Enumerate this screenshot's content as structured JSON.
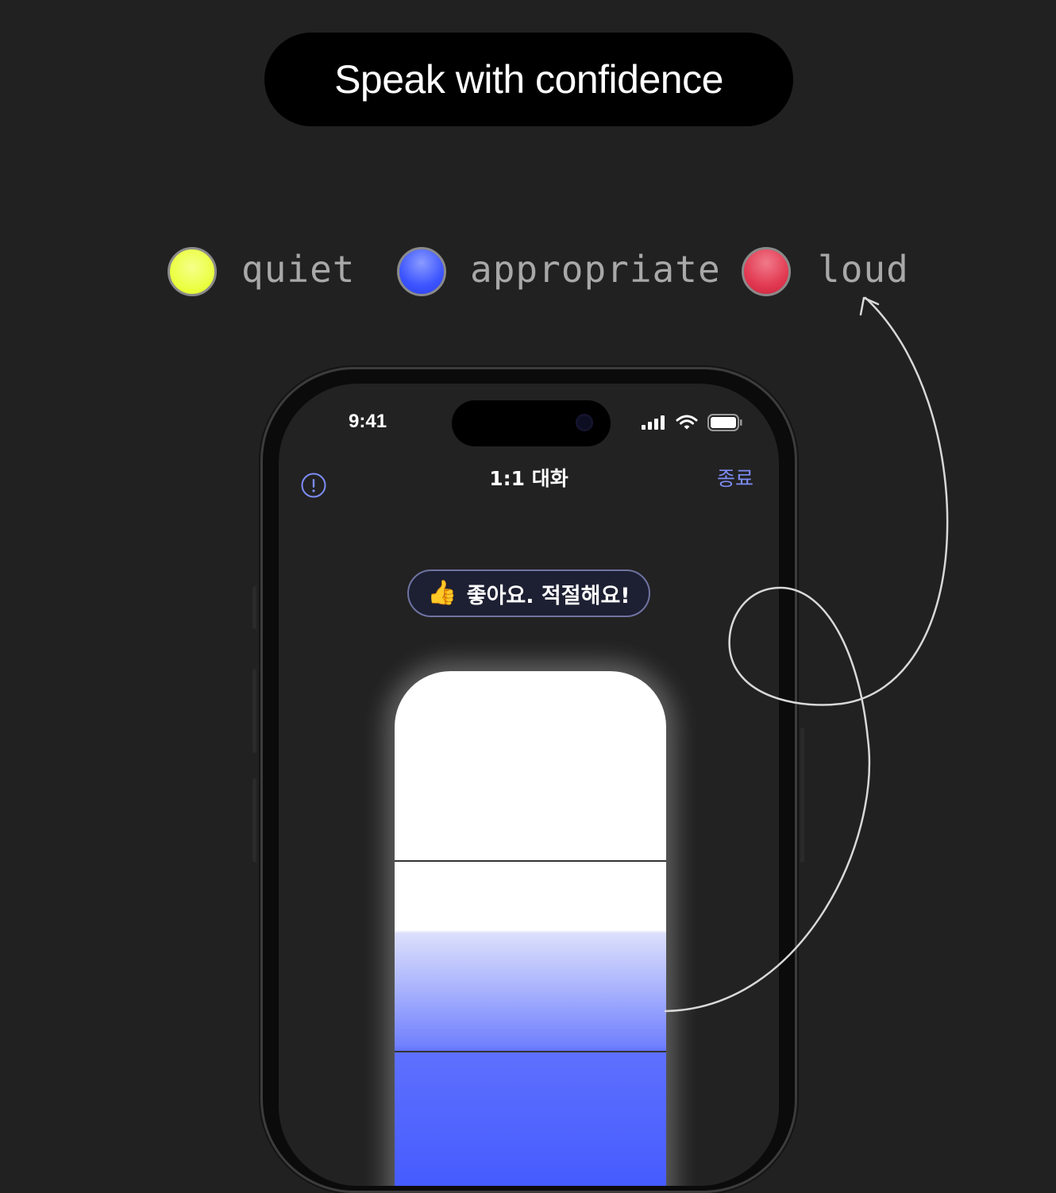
{
  "headline": "Speak with confidence",
  "legend": [
    {
      "label": "quiet",
      "color": "#f2ff66",
      "icon": "yellow-circle"
    },
    {
      "label": "appropriate",
      "color": "#3d55ff",
      "icon": "blue-circle"
    },
    {
      "label": "loud",
      "color": "#e23a52",
      "icon": "red-circle"
    }
  ],
  "phone": {
    "status_bar": {
      "time": "9:41",
      "icons": [
        "cellular-signal-icon",
        "wifi-icon",
        "battery-icon"
      ]
    },
    "nav": {
      "info_icon": "info-icon",
      "title": "1:1 대화",
      "end_label": "종료",
      "end_color": "#7d8cf5"
    },
    "feedback": {
      "emoji": "👍",
      "message": "좋아요. 적절해요!"
    },
    "volume_meter": {
      "level": 0.43,
      "state": "appropriate",
      "fill_color": "#3f55fe"
    }
  }
}
